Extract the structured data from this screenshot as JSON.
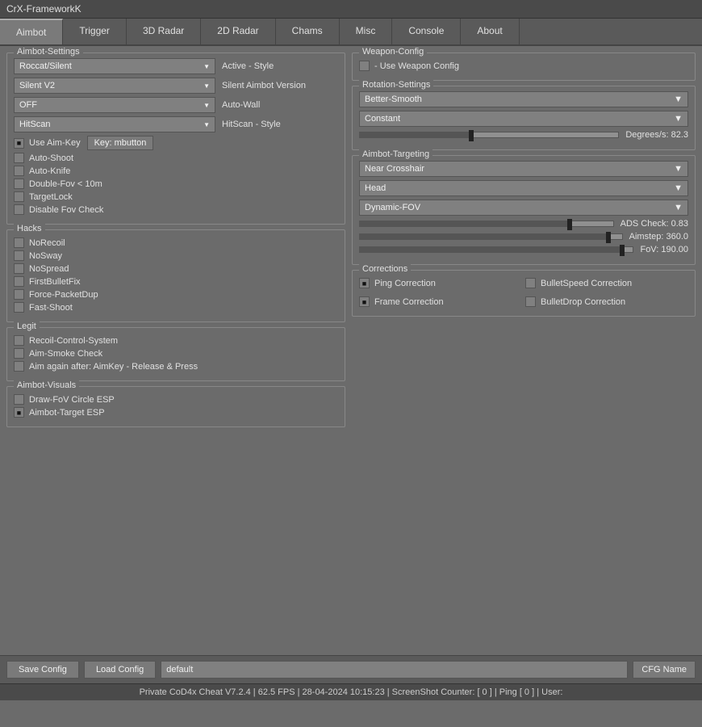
{
  "titleBar": {
    "label": "CrX-FrameworkK"
  },
  "tabs": [
    {
      "id": "aimbot",
      "label": "Aimbot",
      "active": true
    },
    {
      "id": "trigger",
      "label": "Trigger",
      "active": false
    },
    {
      "id": "radar3d",
      "label": "3D Radar",
      "active": false
    },
    {
      "id": "radar2d",
      "label": "2D Radar",
      "active": false
    },
    {
      "id": "chams",
      "label": "Chams",
      "active": false
    },
    {
      "id": "misc",
      "label": "Misc",
      "active": false
    },
    {
      "id": "console",
      "label": "Console",
      "active": false
    },
    {
      "id": "about",
      "label": "About",
      "active": false
    }
  ],
  "aimbot": {
    "settingsGroup": "Aimbot-Settings",
    "dropdowns": [
      {
        "value": "Roccat/Silent",
        "label": "Active - Style"
      },
      {
        "value": "Silent V2",
        "label": "Silent Aimbot Version"
      },
      {
        "value": "OFF",
        "label": "Auto-Wall"
      },
      {
        "value": "HitScan",
        "label": "HitScan - Style"
      }
    ],
    "useAimKey": {
      "label": "Use Aim-Key",
      "checked": true
    },
    "keyButton": "Key: mbutton",
    "checkboxes": [
      {
        "label": "Auto-Shoot",
        "checked": false
      },
      {
        "label": "Auto-Knife",
        "checked": false
      },
      {
        "label": "Double-Fov  < 10m",
        "checked": false
      },
      {
        "label": "TargetLock",
        "checked": false
      },
      {
        "label": "Disable Fov Check",
        "checked": false
      }
    ],
    "hacksGroup": "Hacks",
    "hacks": [
      {
        "label": "NoRecoil",
        "checked": false
      },
      {
        "label": "NoSway",
        "checked": false
      },
      {
        "label": "NoSpread",
        "checked": false
      },
      {
        "label": "FirstBulletFix",
        "checked": false
      },
      {
        "label": "Force-PacketDup",
        "checked": false
      },
      {
        "label": "Fast-Shoot",
        "checked": false
      }
    ],
    "legitGroup": "Legit",
    "legit": [
      {
        "label": "Recoil-Control-System",
        "checked": false
      },
      {
        "label": "Aim-Smoke Check",
        "checked": false
      },
      {
        "label": "Aim again after: AimKey - Release & Press",
        "checked": false
      }
    ],
    "visualsGroup": "Aimbot-Visuals",
    "visuals": [
      {
        "label": "Draw-FoV Circle ESP",
        "checked": false
      },
      {
        "label": "Aimbot-Target ESP",
        "checked": true
      }
    ]
  },
  "weapon": {
    "group": "Weapon-Config",
    "useWeaponConfig": {
      "label": "- Use Weapon Config",
      "checked": false
    }
  },
  "rotation": {
    "group": "Rotation-Settings",
    "smooth": {
      "value": "Better-Smooth"
    },
    "mode": {
      "value": "Constant"
    },
    "slider": {
      "label": "Degrees/s: 82.3",
      "percent": 45,
      "thumbPercent": 42
    }
  },
  "targeting": {
    "group": "Aimbot-Targeting",
    "target": {
      "value": "Near Crosshair"
    },
    "bone": {
      "value": "Head"
    },
    "fov": {
      "value": "Dynamic-FOV"
    },
    "sliders": [
      {
        "label": "ADS Check: 0.83",
        "percent": 83,
        "thumbPercent": 82
      },
      {
        "label": "Aimstep: 360.0",
        "percent": 95,
        "thumbPercent": 94
      },
      {
        "label": "FoV: 190.00",
        "percent": 96,
        "thumbPercent": 95
      }
    ]
  },
  "corrections": {
    "group": "Corrections",
    "items": [
      {
        "label": "Ping Correction",
        "checked": true
      },
      {
        "label": "BulletSpeed Correction",
        "checked": false
      },
      {
        "label": "Frame Correction",
        "checked": true
      },
      {
        "label": "BulletDrop Correction",
        "checked": false
      }
    ]
  },
  "bottomBar": {
    "saveBtn": "Save Config",
    "loadBtn": "Load Config",
    "cfgValue": "default",
    "cfgNameLabel": "CFG Name"
  },
  "statusBar": {
    "text": "Private CoD4x Cheat V7.2.4  |  62.5 FPS |  28-04-2024  10:15:23  |  ScreenShot Counter: [ 0 ]  |  Ping [ 0 ]  |  User:"
  }
}
